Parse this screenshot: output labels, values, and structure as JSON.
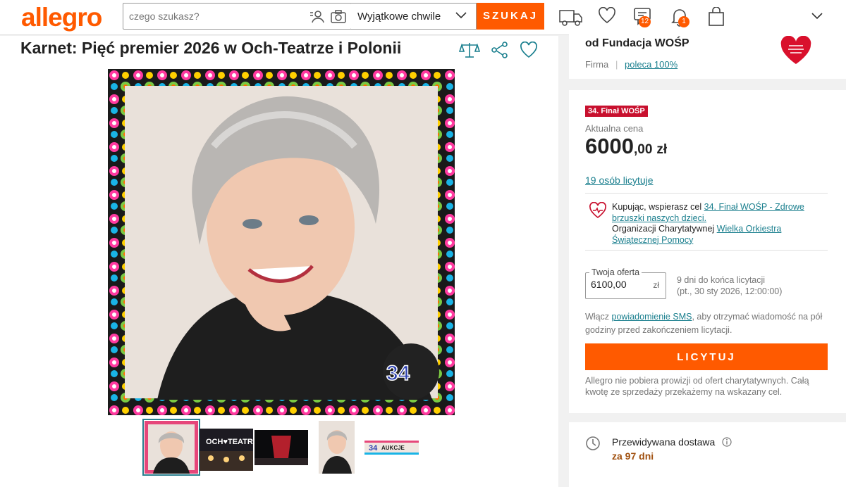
{
  "header": {
    "logo": "allegro",
    "search_placeholder": "czego szukasz?",
    "category": "Wyjątkowe chwile",
    "search_button": "SZUKAJ",
    "messages_count": "12",
    "notifications_count": "1"
  },
  "product": {
    "title": "Karnet: Pięć premier 2026 w Och-Teatrze i Polonii",
    "thumbnails": [
      "photo-portrait",
      "och-teatr",
      "stage-curtain",
      "photo-portrait-2",
      "final-banner"
    ]
  },
  "seller": {
    "name": "od Fundacja WOŚP",
    "type": "Firma",
    "separator": "|",
    "rating": "poleca 100%"
  },
  "offer": {
    "tag": "34. Finał WOŚP",
    "price_label": "Aktualna cena",
    "price_main": "6000",
    "price_decimals": ",00",
    "currency": "zł",
    "bidders": "19 osób licytuje",
    "charity_prefix": "Kupując, wspierasz cel ",
    "charity_goal": "34. Finał WOŚP - Zdrowe brzuszki naszych dzieci.",
    "charity_org_prefix": "Organizacji Charytatywnej ",
    "charity_org": "Wielka Orkiestra Świątecznej Pomocy",
    "bid_label": "Twoja oferta",
    "bid_value": "6100,00",
    "bid_unit": "zł",
    "ends_line1": "9 dni do końca licytacji",
    "ends_line2": "(pt., 30 sty 2026, 12:00:00)",
    "sms_prefix": "Włącz ",
    "sms_link": "powiadomienie SMS",
    "sms_suffix": ", aby otrzymać wiadomość na pół godziny przed zakończeniem licytacji.",
    "bid_button": "LICYTUJ",
    "fee_note": "Allegro nie pobiera prowizji od ofert charytatywnych. Całą kwotę ze sprzedaży przekażemy na wskazany cel."
  },
  "delivery": {
    "label": "Przewidywana dostawa",
    "value": "za 97 dni"
  },
  "colors": {
    "brand": "#ff5a00",
    "link": "#1a7f8e",
    "tag": "#c8102e"
  }
}
